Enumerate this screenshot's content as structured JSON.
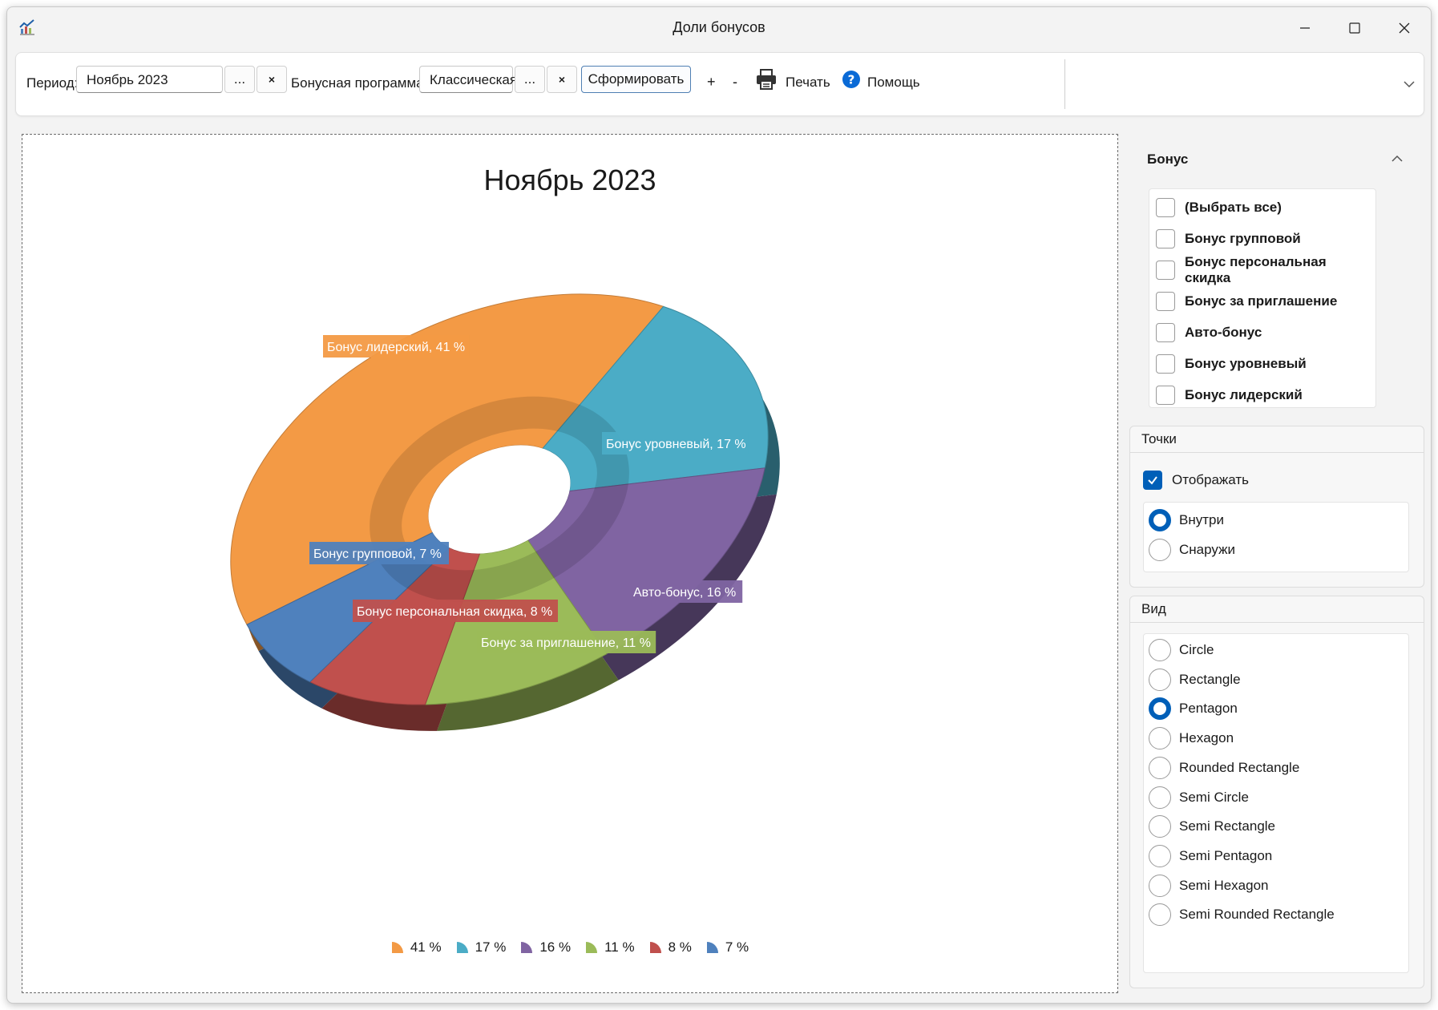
{
  "window": {
    "title": "Доли бонусов"
  },
  "toolbar": {
    "period_label": "Период:",
    "period_value": "Ноябрь 2023",
    "browse_label": "...",
    "clear_label": "×",
    "program_label": "Бонусная программа:",
    "program_value": "Классическая",
    "generate_label": "Сформировать",
    "plus_label": "+",
    "minus_label": "-",
    "print_label": "Печать",
    "help_label": "Помощь"
  },
  "chart_data": {
    "type": "pie",
    "style": "3d-donut",
    "title": "Ноябрь 2023",
    "series": [
      {
        "name": "Бонус лидерский",
        "value": 41,
        "label": "Бонус лидерский, 41 %",
        "legend": "41 %",
        "color": "#f39a45"
      },
      {
        "name": "Бонус уровневый",
        "value": 17,
        "label": "Бонус уровневый, 17 %",
        "legend": "17 %",
        "color": "#4bacc6"
      },
      {
        "name": "Авто-бонус",
        "value": 16,
        "label": "Авто-бонус, 16 %",
        "legend": "16 %",
        "color": "#8064a2"
      },
      {
        "name": "Бонус за приглашение",
        "value": 11,
        "label": "Бонус за приглашение, 11 %",
        "legend": "11 %",
        "color": "#9bbb59"
      },
      {
        "name": "Бонус персональная скидка",
        "value": 8,
        "label": "Бонус персональная скидка, 8 %",
        "legend": "8 %",
        "color": "#c0504d"
      },
      {
        "name": "Бонус групповой",
        "value": 7,
        "label": "Бонус групповой, 7 %",
        "legend": "7 %",
        "color": "#4f81bd"
      }
    ],
    "legend_position": "bottom"
  },
  "filter": {
    "title": "Бонус",
    "items": [
      {
        "label": "(Выбрать все)",
        "checked": false
      },
      {
        "label": "Бонус групповой",
        "checked": false
      },
      {
        "label": "Бонус персональная скидка",
        "checked": false
      },
      {
        "label": "Бонус за приглашение",
        "checked": false
      },
      {
        "label": "Авто-бонус",
        "checked": false
      },
      {
        "label": "Бонус уровневый",
        "checked": false
      },
      {
        "label": "Бонус лидерский",
        "checked": false
      }
    ]
  },
  "points": {
    "title": "Точки",
    "show_label": "Отображать",
    "show_checked": true,
    "options": [
      {
        "label": "Внутри",
        "selected": true
      },
      {
        "label": "Снаружи",
        "selected": false
      }
    ]
  },
  "view": {
    "title": "Вид",
    "options": [
      {
        "label": "Circle",
        "selected": false
      },
      {
        "label": "Rectangle",
        "selected": false
      },
      {
        "label": "Pentagon",
        "selected": true
      },
      {
        "label": "Hexagon",
        "selected": false
      },
      {
        "label": "Rounded Rectangle",
        "selected": false
      },
      {
        "label": "Semi Circle",
        "selected": false
      },
      {
        "label": "Semi Rectangle",
        "selected": false
      },
      {
        "label": "Semi Pentagon",
        "selected": false
      },
      {
        "label": "Semi Hexagon",
        "selected": false
      },
      {
        "label": "Semi Rounded Rectangle",
        "selected": false
      }
    ]
  }
}
